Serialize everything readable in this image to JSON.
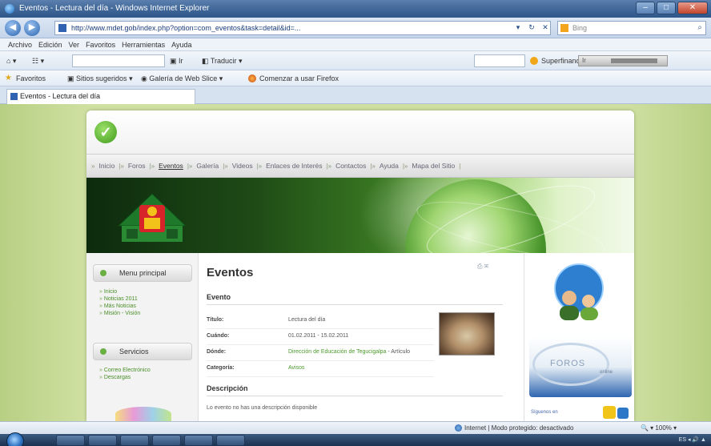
{
  "window": {
    "title": "Eventos - Lectura del día - Windows Internet Explorer",
    "buttons": {
      "minimize": "–",
      "maximize": "□",
      "close": "✕"
    }
  },
  "addressbar": {
    "url": "http://www.mdet.gob/index.php?option=com_eventos&task=detail&id=...",
    "search_placeholder": "Bing",
    "tools": [
      "▾",
      "↻",
      "✕"
    ]
  },
  "menubar": [
    "Archivo",
    "Edición",
    "Ver",
    "Favoritos",
    "Herramientas",
    "Ayuda"
  ],
  "toolbar": {
    "items": [
      "Ir",
      "Traducir"
    ],
    "signin": "Superfinanciero",
    "dropdown_label": "Ir"
  },
  "favorites": {
    "label": "Favoritos",
    "items": [
      "Sitios sugeridos",
      "Galería de Web Slice",
      "Comenzar a usar Firefox"
    ]
  },
  "tab": {
    "label": "Eventos - Lectura del día"
  },
  "site": {
    "nav": [
      "Inicio",
      "Foros",
      "Eventos",
      "Galería",
      "Videos",
      "Enlaces de Interés",
      "Contactos",
      "Ayuda",
      "Mapa del Sitio"
    ],
    "active_nav_index": 2,
    "menus": [
      {
        "title": "Menu principal",
        "items": [
          "Inicio",
          "Noticias 2011",
          "Más Noticias",
          "Misión - Visión"
        ]
      },
      {
        "title": "Servicios",
        "items": [
          "Correo Electrónico",
          "Descargas"
        ]
      }
    ],
    "content": {
      "page_title": "Eventos",
      "ctl_icons": "⎙ ✉",
      "section_event": "Evento",
      "rows": [
        {
          "label": "Título:",
          "value": "Lectura del día"
        },
        {
          "label": "Cuándo:",
          "value": "01.02.2011 - 15.02.2011"
        },
        {
          "label": "Dónde:",
          "value": "Dirección de Educación de Tegucigalpa",
          "extra": " - Artículo"
        },
        {
          "label": "Categoría:",
          "value": "Avisos"
        }
      ],
      "section_desc": "Descripción",
      "desc_text": "Lo evento no has una descripción disponible"
    },
    "right": {
      "foros_text": "FOROS",
      "foros_sub": "online",
      "badge_text": "Síguenos en"
    }
  },
  "statusbar": {
    "zone": "Internet | Modo protegido: desactivado",
    "zoom": "100%"
  },
  "taskbar": {
    "tray": "ES  ◂  🔊  ▲"
  },
  "colors": {
    "page_bg": "#cfe0a1",
    "link_green": "#4b9a2b",
    "ie_blue": "#3d6496"
  }
}
